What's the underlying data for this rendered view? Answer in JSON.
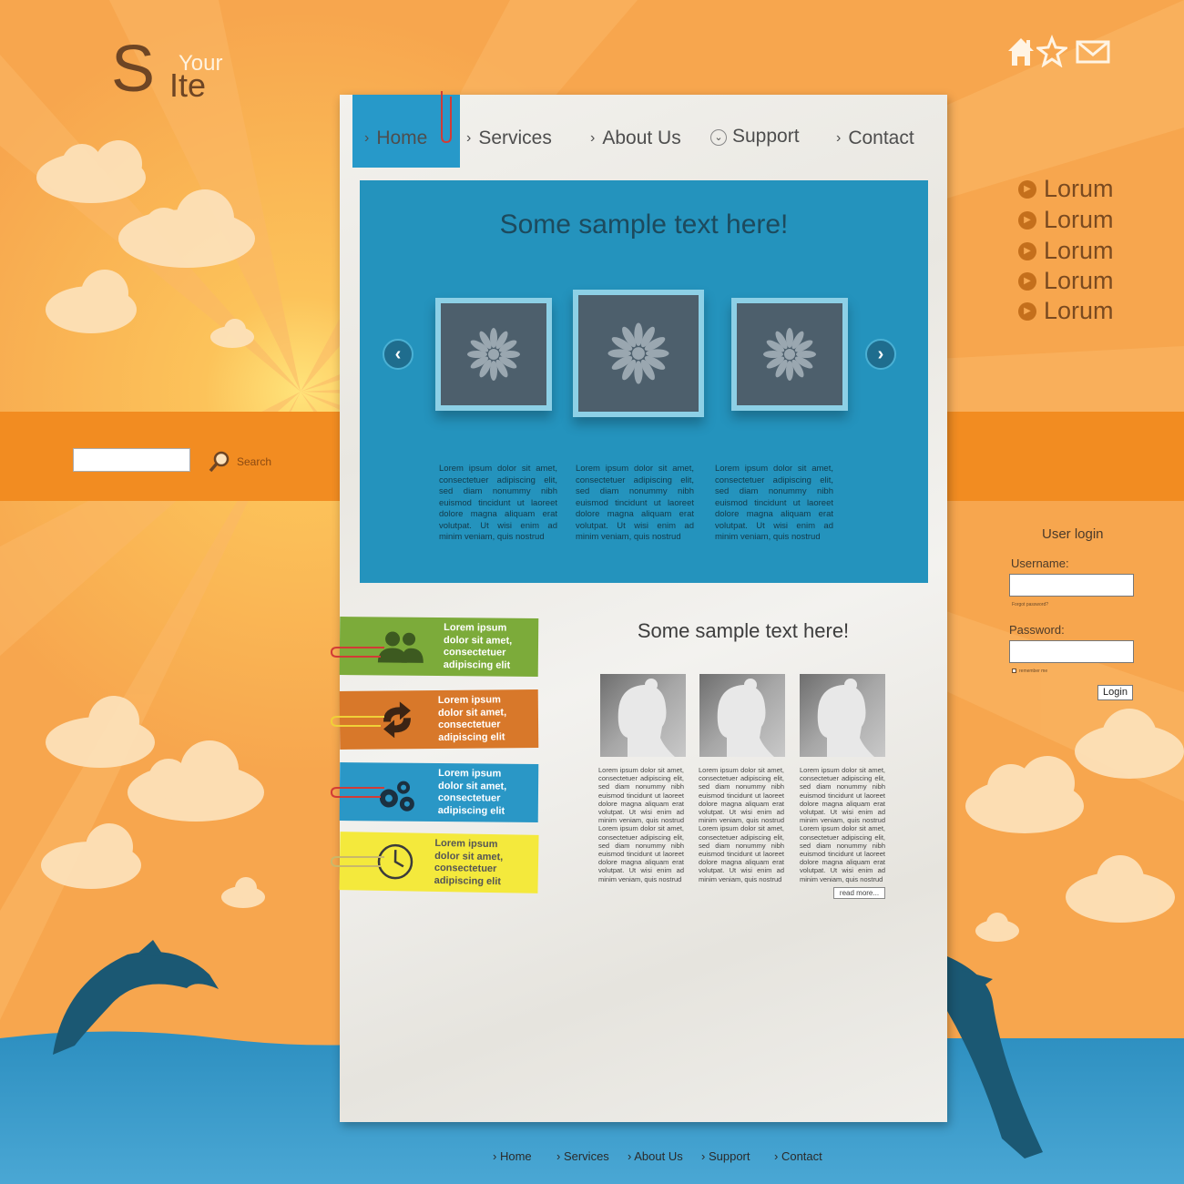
{
  "logo": {
    "s": "S",
    "ite": "Ite",
    "your": "Your"
  },
  "top_icons": [
    "home-icon",
    "star-icon",
    "mail-icon"
  ],
  "nav": {
    "items": [
      {
        "label": "Home",
        "active": true
      },
      {
        "label": "Services"
      },
      {
        "label": "About Us"
      },
      {
        "label": "Support"
      },
      {
        "label": "Contact"
      }
    ]
  },
  "hero": {
    "title": "Some sample text here!",
    "columns": [
      "Lorem ipsum dolor sit amet, consectetuer adipiscing elit, sed diam nonummy nibh euismod tincidunt ut laoreet dolore magna aliquam erat volutpat. Ut wisi enim ad minim veniam, quis nostrud",
      "Lorem ipsum dolor sit amet, consectetuer adipiscing elit, sed diam nonummy nibh euismod tincidunt ut laoreet dolore magna aliquam erat volutpat. Ut wisi enim ad minim veniam, quis nostrud",
      "Lorem ipsum dolor sit amet, consectetuer adipiscing elit, sed diam nonummy nibh euismod tincidunt ut laoreet dolore magna aliquam erat volutpat. Ut wisi enim ad minim veniam, quis nostrud"
    ]
  },
  "sidebar_links": [
    "Lorum",
    "Lorum",
    "Lorum",
    "Lorum",
    "Lorum"
  ],
  "search": {
    "label": "Search",
    "value": ""
  },
  "login": {
    "title": "User login",
    "username_label": "Username:",
    "forgot": "Forgot password?",
    "password_label": "Password:",
    "remember": "remember me",
    "button": "Login"
  },
  "notes": [
    {
      "text1": "Lorem ipsum",
      "text2": "dolor sit amet,",
      "text3": "consectetuer",
      "text4": "adipiscing elit",
      "icon": "users-icon",
      "color": "#7cab3a"
    },
    {
      "text1": "Lorem ipsum",
      "text2": "dolor sit amet,",
      "text3": "consectetuer",
      "text4": "adipiscing elit",
      "icon": "refresh-icon",
      "color": "#d8782a"
    },
    {
      "text1": "Lorem ipsum",
      "text2": "dolor sit amet,",
      "text3": "consectetuer",
      "text4": "adipiscing elit",
      "icon": "gears-icon",
      "color": "#2a97c6"
    },
    {
      "text1": "Lorem ipsum",
      "text2": "dolor sit amet,",
      "text3": "consectetuer",
      "text4": "adipiscing elit",
      "icon": "clock-icon",
      "color": "#f4e93c"
    }
  ],
  "section2": {
    "title": "Some sample text here!",
    "columns": [
      "Lorem ipsum dolor sit amet, consectetuer adipiscing elit, sed diam nonummy nibh euismod tincidunt ut laoreet dolore magna aliquam erat volutpat. Ut wisi enim ad minim veniam, quis nostrud Lorem ipsum dolor sit amet, consectetuer adipiscing elit, sed diam nonummy nibh euismod tincidunt ut laoreet dolore magna aliquam erat volutpat. Ut wisi enim ad minim veniam, quis nostrud",
      "Lorem ipsum dolor sit amet, consectetuer adipiscing elit, sed diam nonummy nibh euismod tincidunt ut laoreet dolore magna aliquam erat volutpat. Ut wisi enim ad minim veniam, quis nostrud Lorem ipsum dolor sit amet, consectetuer adipiscing elit, sed diam nonummy nibh euismod tincidunt ut laoreet dolore magna aliquam erat volutpat. Ut wisi enim ad minim veniam, quis nostrud",
      "Lorem ipsum dolor sit amet, consectetuer adipiscing elit, sed diam nonummy nibh euismod tincidunt ut laoreet dolore magna aliquam erat volutpat. Ut wisi enim ad minim veniam, quis nostrud Lorem ipsum dolor sit amet, consectetuer adipiscing elit, sed diam nonummy nibh euismod tincidunt ut laoreet dolore magna aliquam erat volutpat. Ut wisi enim ad minim veniam, quis nostrud"
    ],
    "read_more": "read more..."
  },
  "footer": [
    "Home",
    "Services",
    "About Us",
    "Support",
    "Contact"
  ],
  "colors": {
    "orange": "#f7a952",
    "band": "#f28c21",
    "blue": "#2493bd",
    "sea": "#2f93c3",
    "dolphin": "#1b5873"
  }
}
